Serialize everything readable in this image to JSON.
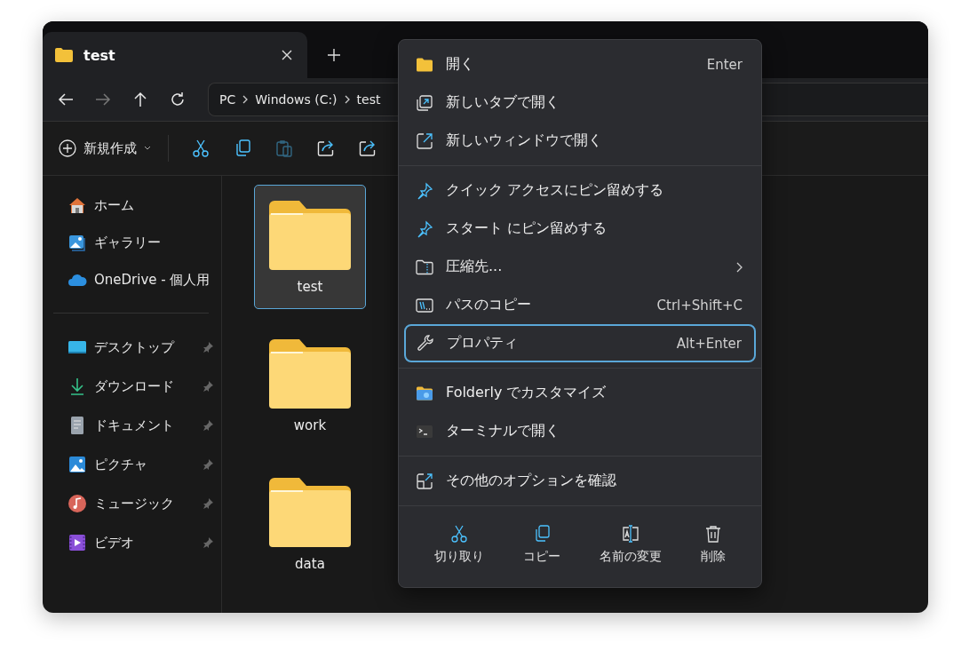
{
  "tabs": [
    {
      "label": "test",
      "selected": true
    }
  ],
  "nav": [
    {
      "kind": "back",
      "disabled": false
    },
    {
      "kind": "forward",
      "disabled": true
    },
    {
      "kind": "up",
      "disabled": false
    },
    {
      "kind": "refresh",
      "disabled": false
    }
  ],
  "breadcrumb": [
    "PC",
    "Windows (C:)",
    "test"
  ],
  "toolbar": {
    "new_label": "新規作成",
    "actions": [
      {
        "kind": "cut",
        "disabled": false
      },
      {
        "kind": "copy",
        "disabled": false
      },
      {
        "kind": "paste",
        "disabled": true
      },
      {
        "kind": "share",
        "disabled": false
      },
      {
        "kind": "share",
        "disabled": false
      }
    ]
  },
  "sidebar": {
    "sections": [
      [
        {
          "kind": "home",
          "label": "ホーム",
          "pinned": false
        },
        {
          "kind": "gallery",
          "label": "ギャラリー",
          "pinned": false
        },
        {
          "kind": "onedrive",
          "label": "OneDrive - 個人用",
          "pinned": false
        }
      ],
      [
        {
          "kind": "desktop",
          "label": "デスクトップ",
          "pinned": true
        },
        {
          "kind": "download",
          "label": "ダウンロード",
          "pinned": true
        },
        {
          "kind": "documents",
          "label": "ドキュメント",
          "pinned": true
        },
        {
          "kind": "pictures",
          "label": "ピクチャ",
          "pinned": true
        },
        {
          "kind": "music",
          "label": "ミュージック",
          "pinned": true
        },
        {
          "kind": "video",
          "label": "ビデオ",
          "pinned": true
        }
      ]
    ]
  },
  "files": [
    {
      "name": "test",
      "selected": true
    },
    {
      "name": "work",
      "selected": false
    },
    {
      "name": "data",
      "selected": false
    }
  ],
  "context_menu": {
    "groups": [
      [
        {
          "kind": "folder",
          "label": "開く",
          "shortcut": "Enter",
          "submenu": false,
          "focused": false
        },
        {
          "kind": "new-tab",
          "label": "新しいタブで開く",
          "submenu": false,
          "focused": false
        },
        {
          "kind": "new-window",
          "label": "新しいウィンドウで開く",
          "submenu": false,
          "focused": false
        }
      ],
      [
        {
          "kind": "pin",
          "label": "クイック アクセスにピン留めする",
          "submenu": false,
          "focused": false
        },
        {
          "kind": "pin",
          "label": "スタート にピン留めする",
          "submenu": false,
          "focused": false
        },
        {
          "kind": "zip",
          "label": "圧縮先...",
          "submenu": true,
          "focused": false
        },
        {
          "kind": "path",
          "label": "パスのコピー",
          "shortcut": "Ctrl+Shift+C",
          "submenu": false,
          "focused": false
        },
        {
          "kind": "wrench",
          "label": "プロパティ",
          "shortcut": "Alt+Enter",
          "submenu": false,
          "focused": true
        }
      ],
      [
        {
          "kind": "folderly",
          "label": "Folderly でカスタマイズ",
          "submenu": false,
          "focused": false
        },
        {
          "kind": "terminal",
          "label": "ターミナルで開く",
          "submenu": false,
          "focused": false
        }
      ],
      [
        {
          "kind": "more",
          "label": "その他のオプションを確認",
          "submenu": false,
          "focused": false
        }
      ]
    ],
    "actions": [
      {
        "kind": "cut",
        "label": "切り取り"
      },
      {
        "kind": "copy",
        "label": "コピー"
      },
      {
        "kind": "rename",
        "label": "名前の変更"
      },
      {
        "kind": "delete",
        "label": "削除"
      }
    ]
  }
}
